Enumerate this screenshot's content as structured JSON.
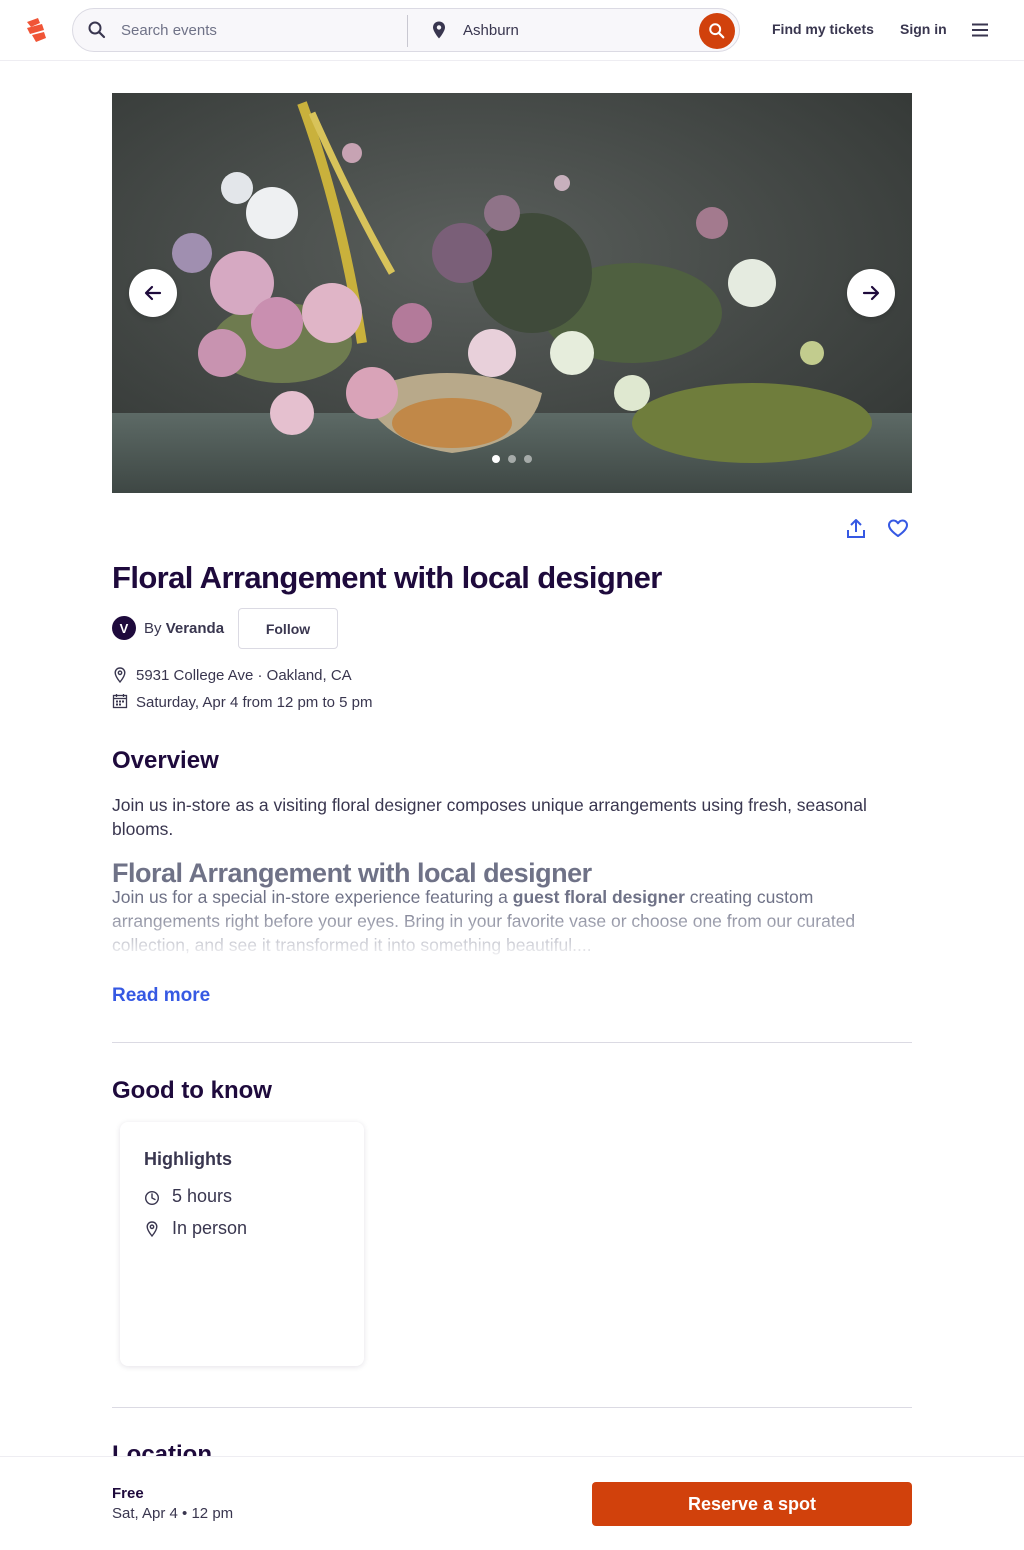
{
  "header": {
    "search_placeholder": "Search events",
    "location_value": "Ashburn",
    "find_tickets": "Find my tickets",
    "sign_in": "Sign in",
    "brand_color": "#d1410c"
  },
  "hero": {
    "slide_count": 3,
    "active_slide": 1
  },
  "event": {
    "title": "Floral Arrangement with local designer",
    "organizer_initial": "V",
    "by_label": "By",
    "organizer_name": "Veranda",
    "follow_label": "Follow",
    "address": "5931 College Ave · Oakland, CA",
    "datetime": "Saturday, Apr 4 from 12 pm to 5 pm"
  },
  "overview": {
    "heading": "Overview",
    "summary": "Join us in-store as a visiting floral designer composes unique arrangements using fresh, seasonal blooms.",
    "desc_heading": "Floral Arrangement with local designer",
    "desc_intro": "Join us for a special in-store experience featuring a ",
    "desc_bold": "guest floral designer",
    "desc_rest": " creating custom arrangements right before your eyes. Bring in your favorite vase or choose one from our curated collection, and see it transformed it into something beautiful....",
    "read_more": "Read more"
  },
  "good_to_know": {
    "heading": "Good to know",
    "card_title": "Highlights",
    "duration": "5 hours",
    "format": "In person"
  },
  "location": {
    "heading": "Location"
  },
  "footer": {
    "price": "Free",
    "when": "Sat, Apr 4 • 12 pm",
    "cta": "Reserve a spot"
  }
}
